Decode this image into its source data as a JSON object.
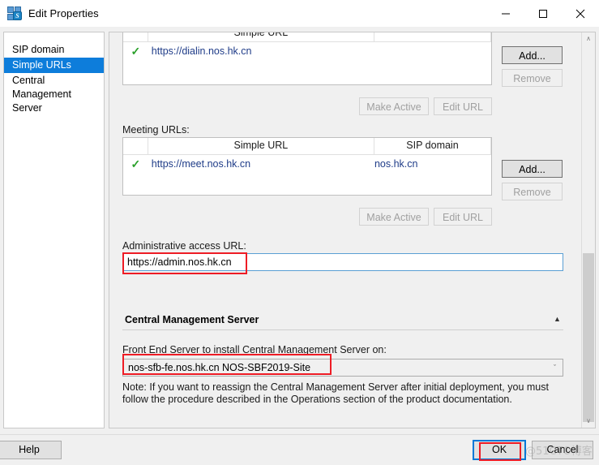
{
  "window": {
    "title": "Edit Properties",
    "icon": "skype-for-business-icon",
    "minimize_label": "─",
    "maximize_label": "☐",
    "close_label": "✕"
  },
  "sidebar": {
    "items": [
      {
        "label": "SIP domain",
        "selected": false
      },
      {
        "label": "Simple URLs",
        "selected": true
      },
      {
        "label": "Central\nManagement\nServer",
        "selected": false
      }
    ]
  },
  "main": {
    "dialin_table": {
      "headers": [
        "",
        "Simple URL",
        "",
        ""
      ],
      "rows": [
        {
          "active": "✓",
          "url": "https://dialin.nos.hk.cn",
          "sip_domain": ""
        }
      ],
      "add_label": "Add...",
      "remove_label": "Remove",
      "make_active_label": "Make Active",
      "edit_url_label": "Edit URL"
    },
    "meeting_section": {
      "label": "Meeting URLs:",
      "headers": [
        "",
        "Simple URL",
        "SIP domain",
        ""
      ],
      "rows": [
        {
          "active": "✓",
          "url": "https://meet.nos.hk.cn",
          "sip_domain": "nos.hk.cn"
        }
      ],
      "add_label": "Add...",
      "remove_label": "Remove",
      "make_active_label": "Make Active",
      "edit_url_label": "Edit URL"
    },
    "admin_url": {
      "label": "Administrative access URL:",
      "value": "https://admin.nos.hk.cn",
      "placeholder": ""
    },
    "cms_group": {
      "title": "Central Management Server",
      "collapse_arrow": "▲",
      "field_label": "Front End Server to install Central Management Server on:",
      "selected_value": "nos-sfb-fe.nos.hk.cn   NOS-SBF2019-Site",
      "dropdown_arrow": "ˇ",
      "note": "Note: If you want to reassign the Central Management Server after initial deployment, you must follow the procedure described in the Operations section of the product documentation."
    }
  },
  "scrollbar": {
    "up_arrow": "∧",
    "down_arrow": "∨"
  },
  "footer": {
    "help_label": "Help",
    "ok_label": "OK",
    "cancel_label": "Cancel"
  },
  "watermark": {
    "text": "@51CTO博客"
  },
  "colors": {
    "accent": "#0d7ddb",
    "annotation": "#ee1c25",
    "link": "#1f3c88",
    "checkmark": "#2aa02a",
    "dialog_bg": "#f0f0f0"
  }
}
